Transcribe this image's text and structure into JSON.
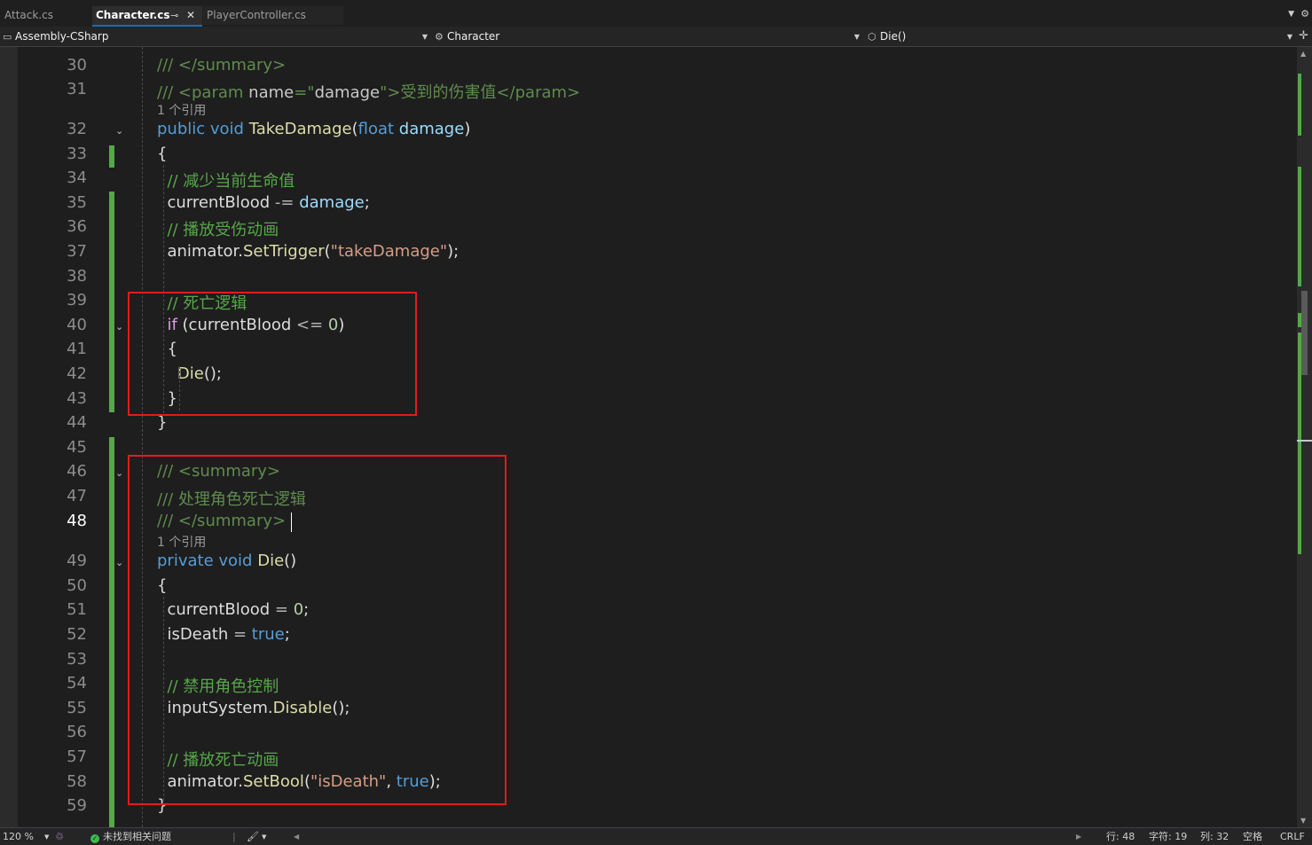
{
  "tabs": [
    {
      "label": "Attack.cs",
      "active": false
    },
    {
      "label": "Character.cs",
      "active": true
    },
    {
      "label": "PlayerController.cs",
      "active": false
    }
  ],
  "tab_icons": {
    "pin": "pin-icon",
    "close": "close-icon"
  },
  "navbar": {
    "project": "Assembly-CSharp",
    "type": "Character",
    "member": "Die()"
  },
  "editor": {
    "lines": [
      {
        "n": "30",
        "tokens": [
          {
            "t": "/// </summary>",
            "c": "doc"
          }
        ]
      },
      {
        "n": "31",
        "tokens": [
          {
            "t": "/// ",
            "c": "doc"
          },
          {
            "t": "<param ",
            "c": "doc"
          },
          {
            "t": "name",
            "c": "xml"
          },
          {
            "t": "=\"",
            "c": "doc"
          },
          {
            "t": "damage",
            "c": "xml"
          },
          {
            "t": "\">受到的伤害值</param>",
            "c": "doc"
          }
        ]
      },
      {
        "n": "32",
        "tokens": [
          {
            "t": "public ",
            "c": "kw"
          },
          {
            "t": "void ",
            "c": "kw"
          },
          {
            "t": "TakeDamage",
            "c": "fn"
          },
          {
            "t": "(",
            "c": ""
          },
          {
            "t": "float ",
            "c": "kw"
          },
          {
            "t": "damage",
            "c": "par"
          },
          {
            "t": ")",
            "c": ""
          }
        ]
      },
      {
        "n": "33",
        "tokens": [
          {
            "t": "{",
            "c": ""
          }
        ]
      },
      {
        "n": "34",
        "tokens": [
          {
            "t": "  // 减少当前生命值",
            "c": "com"
          }
        ]
      },
      {
        "n": "35",
        "tokens": [
          {
            "t": "  currentBlood ",
            "c": ""
          },
          {
            "t": "-= ",
            "c": "op"
          },
          {
            "t": "damage",
            "c": "par"
          },
          {
            "t": ";",
            "c": ""
          }
        ]
      },
      {
        "n": "36",
        "tokens": [
          {
            "t": "  // 播放受伤动画",
            "c": "com"
          }
        ]
      },
      {
        "n": "37",
        "tokens": [
          {
            "t": "  animator.",
            "c": ""
          },
          {
            "t": "SetTrigger",
            "c": "fn"
          },
          {
            "t": "(",
            "c": ""
          },
          {
            "t": "\"takeDamage\"",
            "c": "str"
          },
          {
            "t": ");",
            "c": ""
          }
        ]
      },
      {
        "n": "38",
        "tokens": []
      },
      {
        "n": "39",
        "tokens": [
          {
            "t": "  // 死亡逻辑",
            "c": "com"
          }
        ]
      },
      {
        "n": "40",
        "tokens": [
          {
            "t": "  ",
            "c": ""
          },
          {
            "t": "if",
            "c": "ctl"
          },
          {
            "t": " (currentBlood ",
            "c": ""
          },
          {
            "t": "<= ",
            "c": "op"
          },
          {
            "t": "0",
            "c": "num"
          },
          {
            "t": ")",
            "c": ""
          }
        ]
      },
      {
        "n": "41",
        "tokens": [
          {
            "t": "  {",
            "c": ""
          }
        ]
      },
      {
        "n": "42",
        "tokens": [
          {
            "t": "    ",
            "c": ""
          },
          {
            "t": "Die",
            "c": "fn"
          },
          {
            "t": "();",
            "c": ""
          }
        ]
      },
      {
        "n": "43",
        "tokens": [
          {
            "t": "  }",
            "c": ""
          }
        ]
      },
      {
        "n": "44",
        "tokens": [
          {
            "t": "}",
            "c": ""
          }
        ]
      },
      {
        "n": "45",
        "tokens": []
      },
      {
        "n": "46",
        "tokens": [
          {
            "t": "/// <summary>",
            "c": "doc"
          }
        ]
      },
      {
        "n": "47",
        "tokens": [
          {
            "t": "/// 处理角色死亡逻辑",
            "c": "doc"
          }
        ]
      },
      {
        "n": "48",
        "tokens": [
          {
            "t": "/// </summary>",
            "c": "doc"
          }
        ]
      },
      {
        "n": "49",
        "tokens": [
          {
            "t": "private ",
            "c": "kw"
          },
          {
            "t": "void ",
            "c": "kw"
          },
          {
            "t": "Die",
            "c": "fn"
          },
          {
            "t": "()",
            "c": ""
          }
        ]
      },
      {
        "n": "50",
        "tokens": [
          {
            "t": "{",
            "c": ""
          }
        ]
      },
      {
        "n": "51",
        "tokens": [
          {
            "t": "  currentBlood ",
            "c": ""
          },
          {
            "t": "= ",
            "c": "op"
          },
          {
            "t": "0",
            "c": "num"
          },
          {
            "t": ";",
            "c": ""
          }
        ]
      },
      {
        "n": "52",
        "tokens": [
          {
            "t": "  isDeath ",
            "c": ""
          },
          {
            "t": "= ",
            "c": "op"
          },
          {
            "t": "true",
            "c": "kw"
          },
          {
            "t": ";",
            "c": ""
          }
        ]
      },
      {
        "n": "53",
        "tokens": []
      },
      {
        "n": "54",
        "tokens": [
          {
            "t": "  // 禁用角色控制",
            "c": "com"
          }
        ]
      },
      {
        "n": "55",
        "tokens": [
          {
            "t": "  inputSystem.",
            "c": ""
          },
          {
            "t": "Disable",
            "c": "fn"
          },
          {
            "t": "();",
            "c": ""
          }
        ]
      },
      {
        "n": "56",
        "tokens": []
      },
      {
        "n": "57",
        "tokens": [
          {
            "t": "  // 播放死亡动画",
            "c": "com"
          }
        ]
      },
      {
        "n": "58",
        "tokens": [
          {
            "t": "  animator.",
            "c": ""
          },
          {
            "t": "SetBool",
            "c": "fn"
          },
          {
            "t": "(",
            "c": ""
          },
          {
            "t": "\"isDeath\"",
            "c": "str"
          },
          {
            "t": ", ",
            "c": ""
          },
          {
            "t": "true",
            "c": "kw"
          },
          {
            "t": ");",
            "c": ""
          }
        ]
      },
      {
        "n": "59",
        "tokens": [
          {
            "t": "}",
            "c": ""
          }
        ]
      }
    ],
    "codelens": [
      "1 个引用",
      "1 个引用"
    ],
    "current_line": "48"
  },
  "statusbar": {
    "zoom": "120 %",
    "issues": "未找到相关问题",
    "row": "行: 48",
    "char": "字符: 19",
    "col": "列: 32",
    "whitespace": "空格",
    "eol": "CRLF"
  },
  "colors": {
    "background": "#1e1e1e",
    "keyword": "#569cd6",
    "comment": "#57a64a",
    "method": "#dcdcaa",
    "string": "#d69d85",
    "highlight_box": "#e41b1b",
    "change_bar": "#57a64a"
  }
}
